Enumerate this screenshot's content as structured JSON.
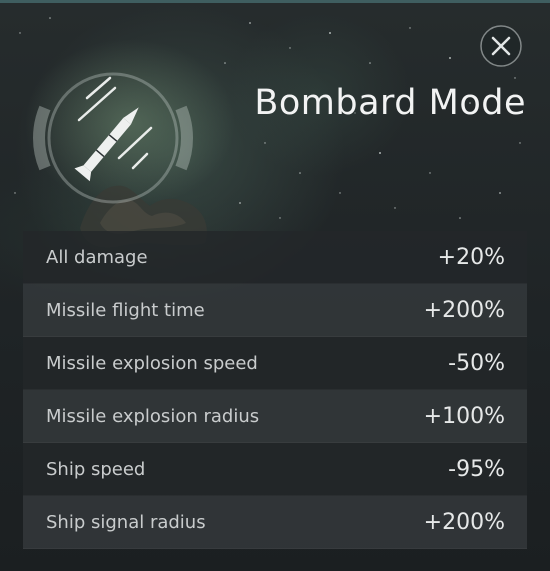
{
  "dialog": {
    "title": "Bombard Mode",
    "close_icon": "close-x-icon",
    "emblem_icon": "missile-bombard-icon"
  },
  "modifiers": [
    {
      "label": "All damage",
      "value": "+20%"
    },
    {
      "label": "Missile flight time",
      "value": "+200%"
    },
    {
      "label": "Missile explosion speed",
      "value": "-50%"
    },
    {
      "label": "Missile explosion radius",
      "value": "+100%"
    },
    {
      "label": "Ship speed",
      "value": "-95%"
    },
    {
      "label": "Ship signal radius",
      "value": "+200%"
    }
  ],
  "colors": {
    "accent": "#3f5e60",
    "title_text": "#f2f3f3",
    "row_dark": "#23272a",
    "row_light": "#34393c"
  }
}
